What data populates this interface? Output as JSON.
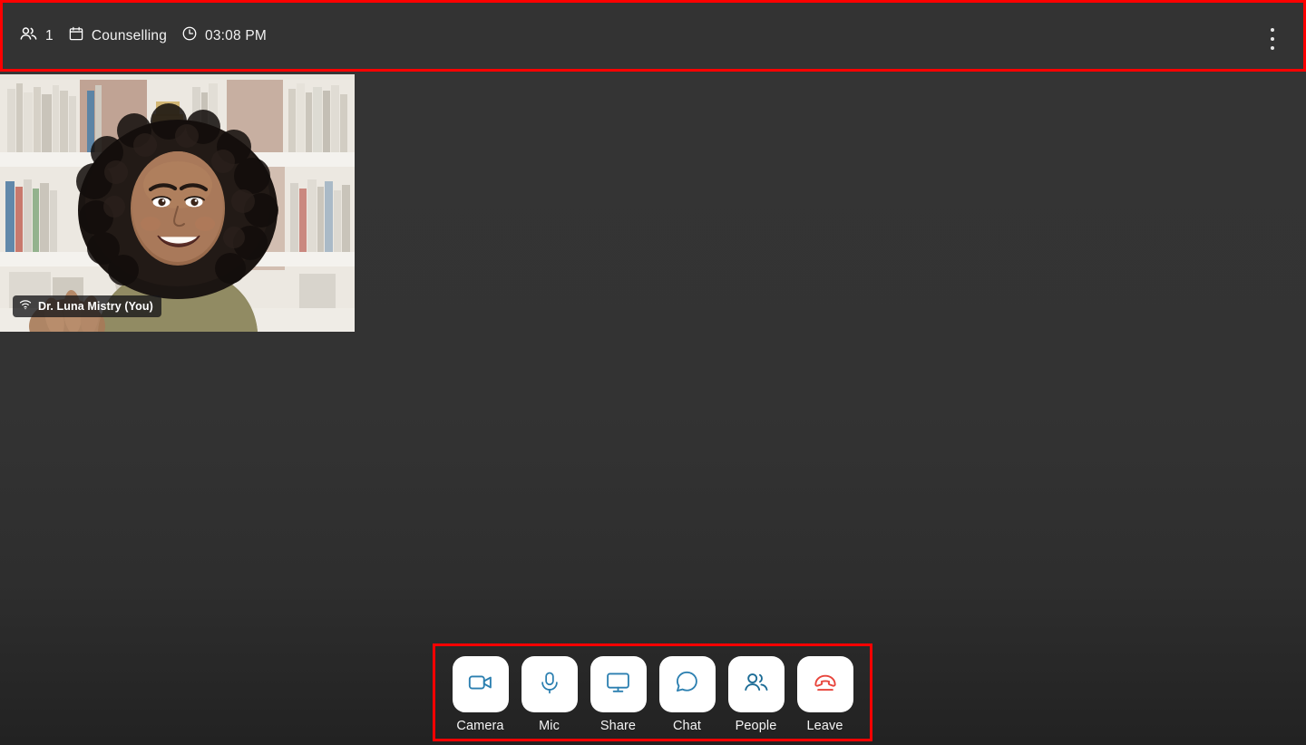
{
  "header": {
    "participants_icon": "people-icon",
    "participant_count": "1",
    "calendar_icon": "calendar-icon",
    "meeting_name": "Counselling",
    "clock_icon": "clock-icon",
    "time": "03:08 PM",
    "menu_icon": "kebab-menu-icon",
    "background_color": "#333333",
    "annotation_color": "#ff0000"
  },
  "video": {
    "participant_name": "Dr. Luna Mistry (You)",
    "signal_icon": "wifi-signal-icon",
    "alt": "Smiling woman with curly hair seated in front of a white bookshelf"
  },
  "controls": {
    "accent_color": "#2b7fb0",
    "leave_color": "#e8453c",
    "items": [
      {
        "label": "Camera",
        "icon": "video-camera-icon"
      },
      {
        "label": "Mic",
        "icon": "microphone-icon"
      },
      {
        "label": "Share",
        "icon": "screen-share-icon"
      },
      {
        "label": "Chat",
        "icon": "chat-bubble-icon"
      },
      {
        "label": "People",
        "icon": "people-icon"
      },
      {
        "label": "Leave",
        "icon": "hangup-phone-icon"
      }
    ]
  }
}
